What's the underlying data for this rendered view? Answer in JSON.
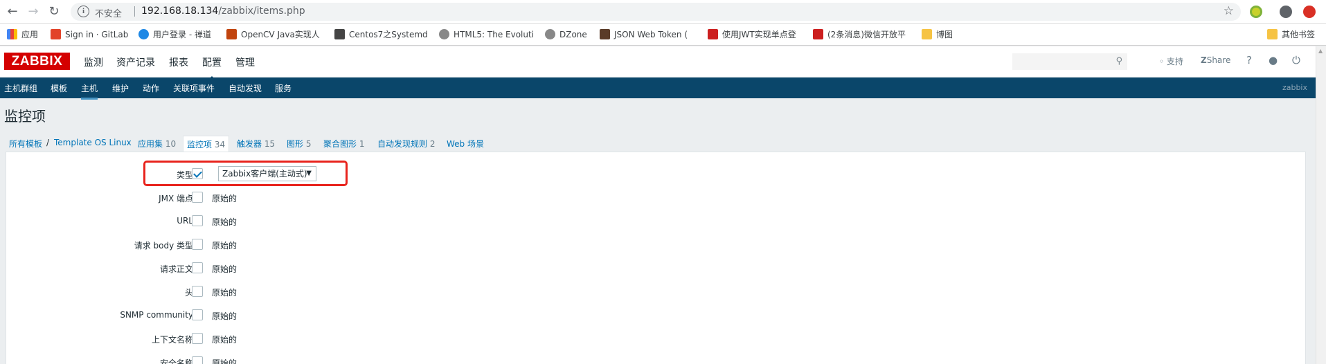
{
  "browser": {
    "insecure_label": "不安全",
    "url_host": "192.168.18.134",
    "url_path": "/zabbix/items.php",
    "bookmarks": [
      {
        "label": "应用",
        "color": "#e34c26"
      },
      {
        "label": "Sign in · GitLab",
        "color": "#e24329"
      },
      {
        "label": "用户登录 - 禅道",
        "color": "#1e88e5"
      },
      {
        "label": "OpenCV Java实现人",
        "color": "#c1440e"
      },
      {
        "label": "Centos7之Systemd",
        "color": "#444444"
      },
      {
        "label": "HTML5: The Evoluti",
        "color": "#888888"
      },
      {
        "label": "DZone",
        "color": "#888888"
      },
      {
        "label": "JSON Web Token (",
        "color": "#5a3b28"
      },
      {
        "label": "使用JWT实现单点登",
        "color": "#cc1f1f"
      },
      {
        "label": "(2条消息)微信开放平",
        "color": "#cc1f1f"
      },
      {
        "label": "博图",
        "color": "#f6c343"
      }
    ],
    "other_bookmarks": "其他书签"
  },
  "header": {
    "logo": "ZABBIX",
    "menu": [
      "监测",
      "资产记录",
      "报表",
      "配置",
      "管理"
    ],
    "active_menu": "配置",
    "support": "支持",
    "share": "Share",
    "help": "?"
  },
  "subnav": {
    "items": [
      "主机群组",
      "模板",
      "主机",
      "维护",
      "动作",
      "关联项事件",
      "自动发现",
      "服务"
    ],
    "active": "主机",
    "user": "zabbix"
  },
  "page": {
    "title": "监控项"
  },
  "breadcrumbs": {
    "all_templates": "所有模板",
    "separator": "/",
    "template": "Template OS Linux",
    "tabs": [
      {
        "label": "应用集",
        "count": "10"
      },
      {
        "label": "监控项",
        "count": "34"
      },
      {
        "label": "触发器",
        "count": "15"
      },
      {
        "label": "图形",
        "count": "5"
      },
      {
        "label": "聚合图形",
        "count": "1"
      },
      {
        "label": "自动发现规则",
        "count": "2"
      },
      {
        "label": "Web 场景",
        "count": ""
      }
    ]
  },
  "form": {
    "original_label": "原始的",
    "type_select": "Zabbix客户端(主动式)",
    "rows": [
      {
        "label": "类型",
        "checked": true
      },
      {
        "label": "JMX 端点",
        "checked": false
      },
      {
        "label": "URL",
        "checked": false
      },
      {
        "label": "请求 body 类型",
        "checked": false
      },
      {
        "label": "请求正文",
        "checked": false
      },
      {
        "label": "头",
        "checked": false
      },
      {
        "label": "SNMP community",
        "checked": false
      },
      {
        "label": "上下文名称",
        "checked": false
      },
      {
        "label": "安全名称",
        "checked": false
      }
    ]
  }
}
